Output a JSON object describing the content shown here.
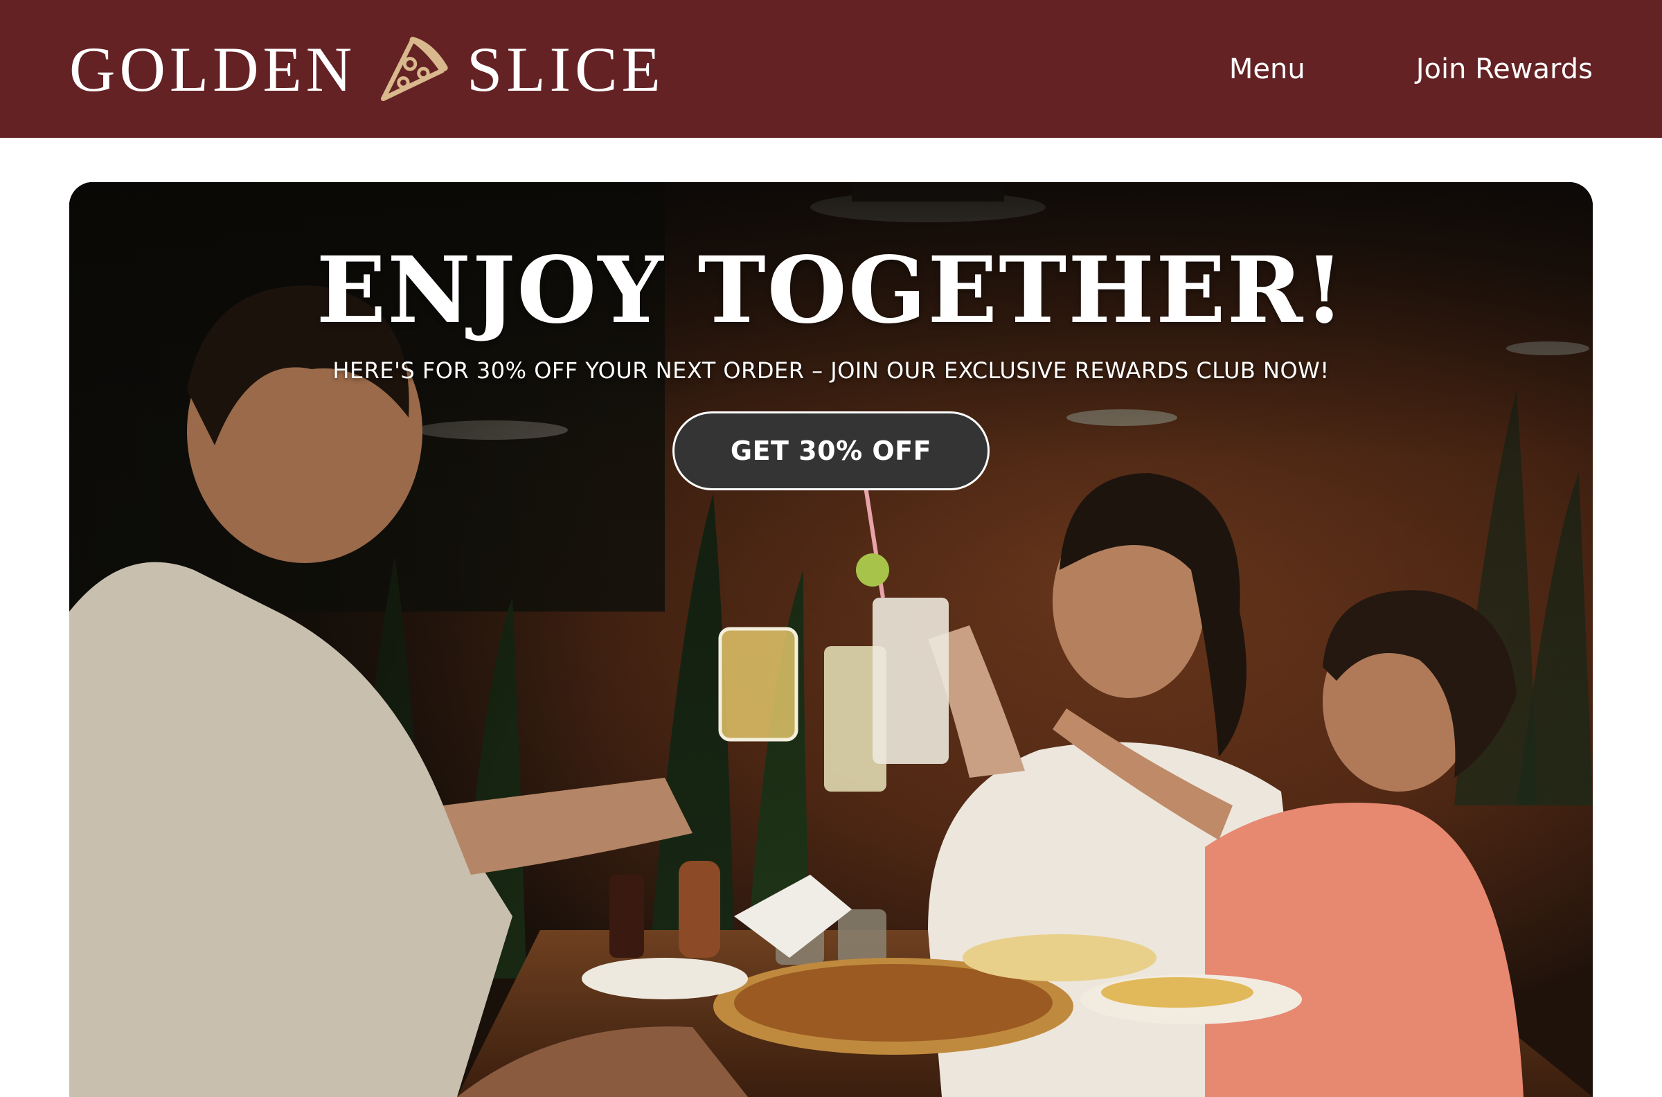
{
  "brand": {
    "name_left": "GOLDEN",
    "name_right": "SLICE",
    "logo_icon": "pizza-slice-icon"
  },
  "nav": {
    "items": [
      {
        "label": "Menu"
      },
      {
        "label": "Join Rewards"
      }
    ]
  },
  "hero": {
    "title": "ENJOY TOGETHER!",
    "subtitle": "HERE'S FOR 30% OFF YOUR NEXT ORDER – JOIN OUR EXCLUSIVE REWARDS CLUB NOW!",
    "cta_label": "GET 30% OFF"
  },
  "colors": {
    "header_bg": "#642224",
    "logo_gold": "#d8b88c",
    "cta_bg": "#343434",
    "text_light": "#ffffff"
  }
}
